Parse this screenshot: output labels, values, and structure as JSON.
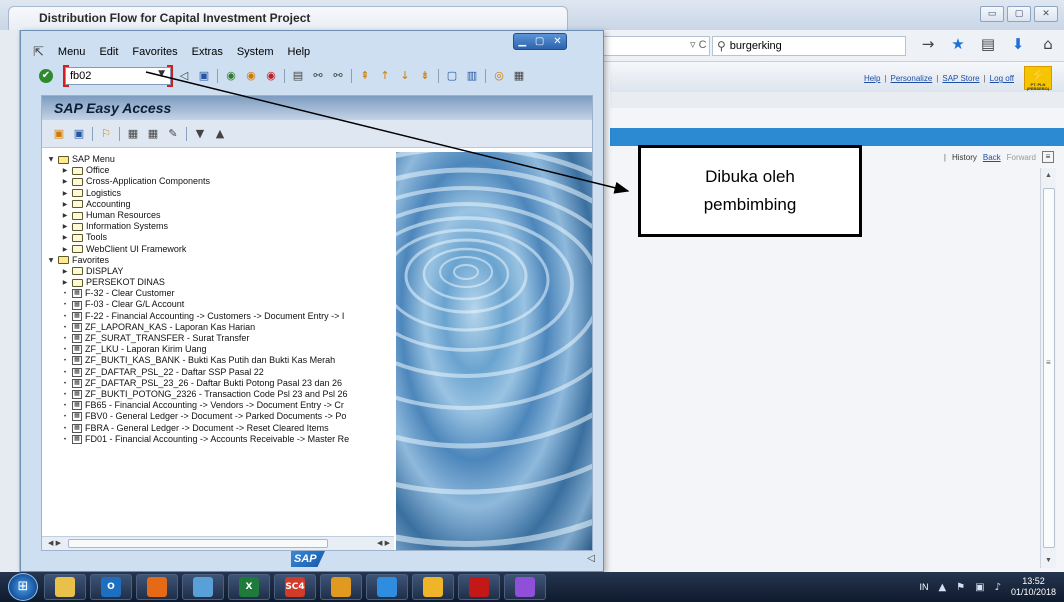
{
  "browser": {
    "tab_title": "Distribution Flow for Capital Investment Project",
    "window_controls": [
      "minimize",
      "maximize",
      "close"
    ],
    "search_value": "burgerking",
    "nav_icons": [
      "arrow-forward-icon",
      "bookmark-star-icon",
      "clipboard-icon",
      "download-icon",
      "home-icon",
      "menu-icon"
    ]
  },
  "portal": {
    "links": [
      "Help",
      "Personalize",
      "SAP Store",
      "Log off"
    ],
    "logo_text": "PT. PLN (PERSERO)",
    "history": {
      "history_label": "History",
      "back_label": "Back",
      "forward_label": "Forward"
    }
  },
  "callout": {
    "line1": "Dibuka oleh",
    "line2": "pembimbing"
  },
  "sap": {
    "menu": [
      "Menu",
      "Edit",
      "Favorites",
      "Extras",
      "System",
      "Help"
    ],
    "tcode_value": "fb02",
    "title": "SAP Easy Access",
    "logo": "SAP",
    "sap_menu": {
      "root": "SAP Menu",
      "items": [
        "Office",
        "Cross-Application Components",
        "Logistics",
        "Accounting",
        "Human Resources",
        "Information Systems",
        "Tools",
        "WebClient UI Framework"
      ]
    },
    "favorites": {
      "root": "Favorites",
      "folders": [
        "DISPLAY",
        "PERSEKOT DINAS"
      ],
      "transactions": [
        "F-32 - Clear Customer",
        "F-03 - Clear G/L Account",
        "F-22 - Financial Accounting -> Customers -> Document Entry -> I",
        "ZF_LAPORAN_KAS - Laporan Kas Harian",
        "ZF_SURAT_TRANSFER - Surat Transfer",
        "ZF_LKU - Laporan Kirim Uang",
        "ZF_BUKTI_KAS_BANK - Bukti Kas Putih dan Bukti Kas Merah",
        "ZF_DAFTAR_PSL_22 - Daftar SSP Pasal 22",
        "ZF_DAFTAR_PSL_23_26 - Daftar Bukti Potong Pasal 23 dan 26",
        "ZF_BUKTI_POTONG_2326 - Transaction Code Psl 23 and Psl 26",
        "FB65 - Financial Accounting -> Vendors -> Document Entry -> Cr",
        "FBV0 - General Ledger -> Document -> Parked Documents -> Po",
        "FBRA - General Ledger -> Document -> Reset Cleared Items",
        "FD01 - Financial Accounting -> Accounts Receivable -> Master Re"
      ]
    }
  },
  "taskbar": {
    "apps": [
      {
        "name": "windows-explorer-icon",
        "color": "#e8c04a",
        "glyph": ""
      },
      {
        "name": "outlook-icon",
        "color": "#1f6fc1",
        "glyph": "O"
      },
      {
        "name": "firefox-icon",
        "color": "#e46a17",
        "glyph": ""
      },
      {
        "name": "folder-icon",
        "color": "#5aa0d8",
        "glyph": ""
      },
      {
        "name": "excel-icon",
        "color": "#1e7b3a",
        "glyph": "X"
      },
      {
        "name": "sc4-icon",
        "color": "#d23a2a",
        "glyph": "SC4"
      },
      {
        "name": "sap-logon-icon",
        "color": "#e09a20",
        "glyph": ""
      },
      {
        "name": "chrome-icon",
        "color": "#2f8de0",
        "glyph": ""
      },
      {
        "name": "sticky-folder-icon",
        "color": "#f0b428",
        "glyph": ""
      },
      {
        "name": "acrobat-icon",
        "color": "#c41818",
        "glyph": ""
      },
      {
        "name": "paint-icon",
        "color": "#8f4fd8",
        "glyph": ""
      }
    ],
    "language": "IN",
    "time": "13:52",
    "date": "01/10/2018"
  }
}
